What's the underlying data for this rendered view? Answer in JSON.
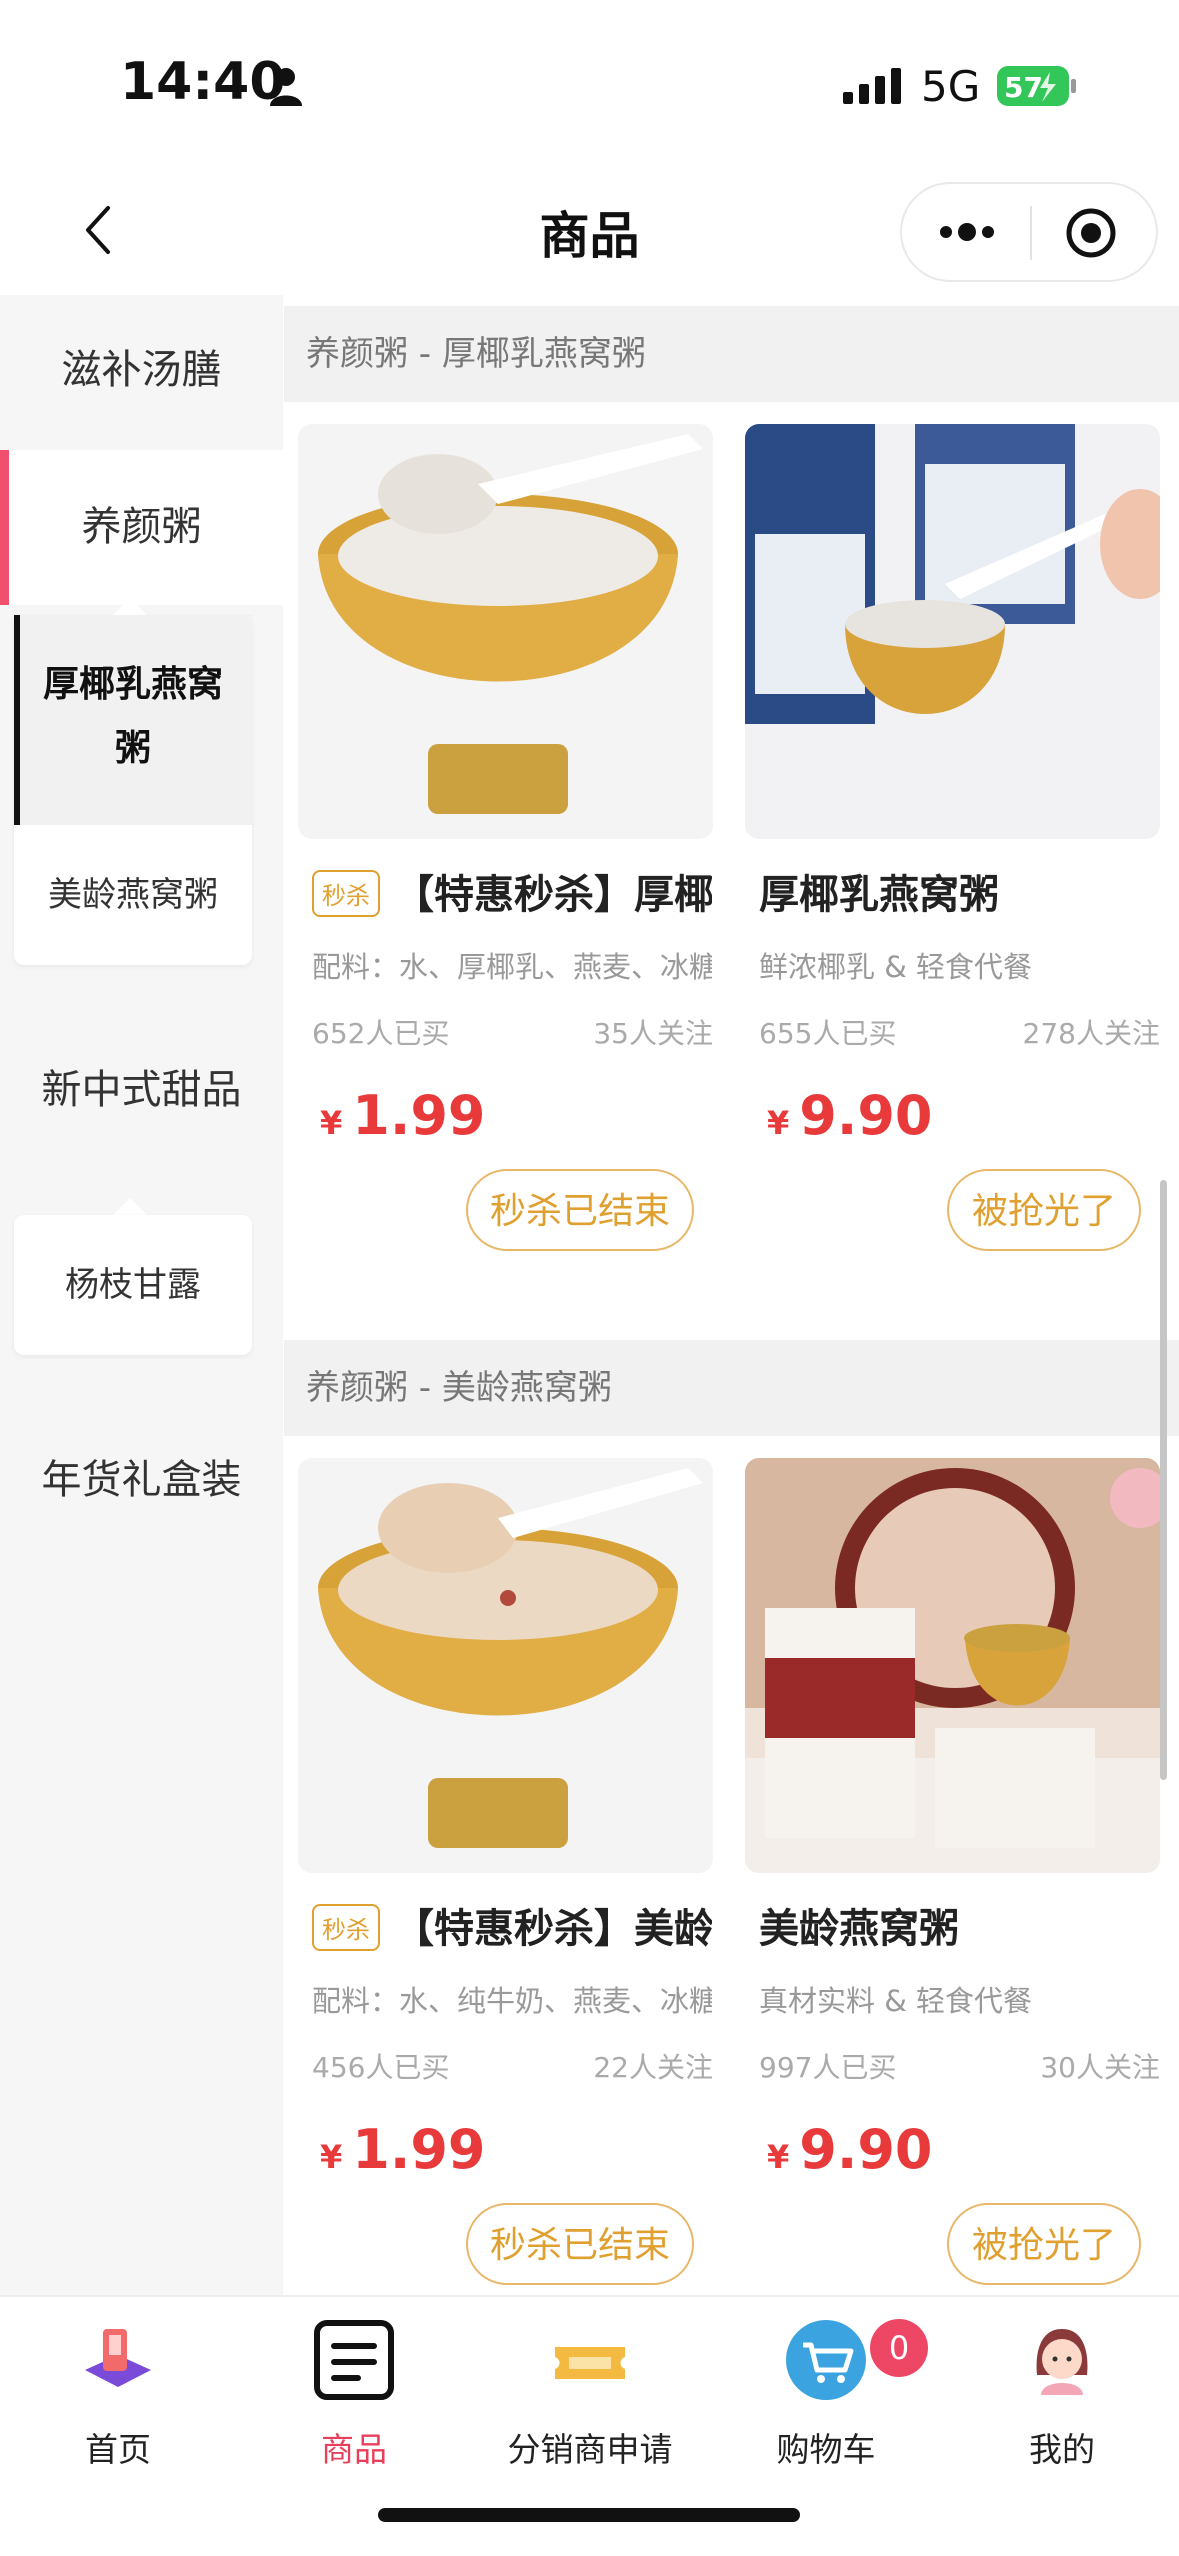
{
  "status": {
    "time": "14:40",
    "network": "5G",
    "battery": "57"
  },
  "nav": {
    "title": "商品"
  },
  "sidebar": {
    "categories": [
      "滋补汤膳",
      "养颜粥",
      "新中式甜品",
      "年货礼盒装"
    ],
    "subs_yangyan": [
      "厚椰乳燕窝粥",
      "美龄燕窝粥"
    ],
    "subs_tianpin": [
      "杨枝甘露"
    ]
  },
  "sections": [
    {
      "title": "养颜粥 - 厚椰乳燕窝粥",
      "products": [
        {
          "tag": "秒杀",
          "name": "【特惠秒杀】厚椰乳燕窝粥",
          "desc": "配料：水、厚椰乳、燕麦、冰糖",
          "bought": "652人已买",
          "follow": "35人关注",
          "currency": "¥",
          "price": "1.99",
          "button": "秒杀已结束"
        },
        {
          "name": "厚椰乳燕窝粥",
          "desc": "鲜浓椰乳 & 轻食代餐",
          "bought": "655人已买",
          "follow": "278人关注",
          "currency": "¥",
          "price": "9.90",
          "button": "被抢光了"
        }
      ]
    },
    {
      "title": "养颜粥 - 美龄燕窝粥",
      "products": [
        {
          "tag": "秒杀",
          "name": "【特惠秒杀】美龄燕窝粥",
          "desc": "配料：水、纯牛奶、燕麦、冰糖",
          "bought": "456人已买",
          "follow": "22人关注",
          "currency": "¥",
          "price": "1.99",
          "button": "秒杀已结束"
        },
        {
          "name": "美龄燕窝粥",
          "desc": "真材实料 & 轻食代餐",
          "bought": "997人已买",
          "follow": "30人关注",
          "currency": "¥",
          "price": "9.90",
          "button": "被抢光了"
        }
      ]
    }
  ],
  "tabbar": {
    "items": [
      "首页",
      "商品",
      "分销商申请",
      "购物车",
      "我的"
    ],
    "cart_count": "0"
  }
}
